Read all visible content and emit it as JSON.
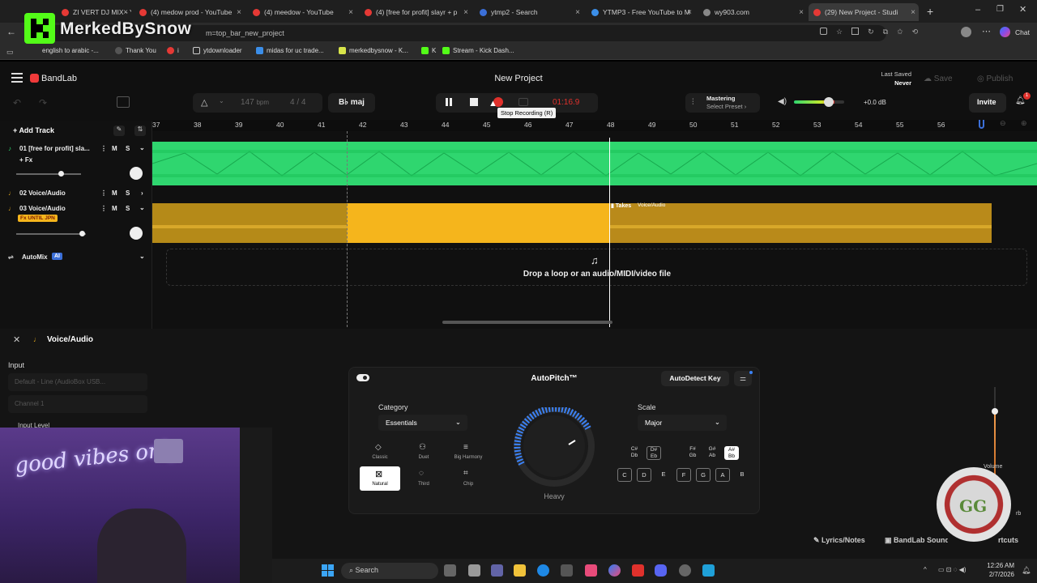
{
  "browser": {
    "tabs": [
      {
        "label": "ZI VERT DJ MIX - Yo",
        "fav": "#e53935"
      },
      {
        "label": "(4) medow prod - YouTube",
        "fav": "#e53935"
      },
      {
        "label": "(4) meedow - YouTube",
        "fav": "#e53935"
      },
      {
        "label": "(4) [free for profit] slayr + p",
        "fav": "#e53935"
      },
      {
        "label": "ytmp2 - Search",
        "fav": "#3b6fd8"
      },
      {
        "label": "YTMP3 - Free YouTube to M",
        "fav": "#3b8ee8"
      },
      {
        "label": "wy903.com",
        "fav": "#888"
      },
      {
        "label": "(29) New Project - Studi",
        "fav": "#e53935"
      }
    ],
    "url_fragment": "m=top_bar_new_project",
    "overlay_name": "MerkedBySnow",
    "chat_label": "Chat",
    "bookmarks": [
      "english to arabic -...",
      "Thank You",
      "i",
      "ytdownloader",
      "midas for uc trade...",
      "merkedbysnow - K...",
      "K",
      "Stream - Kick Dash..."
    ]
  },
  "app": {
    "brand": "BandLab",
    "project_title": "New Project",
    "last_saved_label": "Last Saved",
    "last_saved_value": "Never",
    "save_label": "Save",
    "publish_label": "Publish",
    "invite_label": "Invite",
    "notification_count": "1",
    "bpm_value": "147",
    "bpm_unit": "bpm",
    "time_sig": "4 / 4",
    "key": "B♭ maj",
    "time_display": "01:16.9",
    "tooltip": "Stop Recording (R)",
    "mastering_label": "Mastering",
    "mastering_preset": "Select Preset",
    "gain_label": "+0.0 dB",
    "add_track_label": "Add Track",
    "ruler": [
      "37",
      "38",
      "39",
      "40",
      "41",
      "42",
      "43",
      "44",
      "45",
      "46",
      "47",
      "48",
      "49",
      "50",
      "51",
      "52",
      "53",
      "54",
      "55",
      "56"
    ],
    "tracks": [
      {
        "name": "01  [free for profit] sla...",
        "sub": "+ Fx"
      },
      {
        "name": "02  Voice/Audio"
      },
      {
        "name": "03  Voice/Audio",
        "badge": "Fx UNTIL JPN"
      }
    ],
    "automix_label": "AutoMix",
    "automix_badge": "AI",
    "takes_label": "Takes",
    "clip_label": "Voice/Audio",
    "drop_text": "Drop a loop or an audio/MIDI/video file"
  },
  "panel": {
    "title": "Voice/Audio",
    "input_label": "Input",
    "input_device": "Default - Line (AudioBox USB...",
    "channel": "Channel 1",
    "input_level": "Input Level",
    "autopitch_title": "AutoPitch™",
    "autodetect_label": "AutoDetect Key",
    "category_label": "Category",
    "category_value": "Essentials",
    "scale_label": "Scale",
    "scale_value": "Major",
    "amount_label": "Heavy",
    "options": [
      "Classic",
      "Duet",
      "Big Harmony",
      "Natural",
      "Third",
      "Chip"
    ],
    "sharp_keys": [
      "C#\nDb",
      "D#\nEb",
      "F#\nGb",
      "G#\nAb",
      "A#\nBb"
    ],
    "natural_keys": [
      "C",
      "D",
      "E",
      "F",
      "G",
      "A",
      "B"
    ],
    "volume_label": "Volume",
    "reverb_label": "rb",
    "lyrics_label": "Lyrics/Notes",
    "sounds_label": "BandLab Sounds",
    "shortcuts_label": "rtcuts"
  },
  "taskbar": {
    "search": "Search",
    "time": "12:26 AM",
    "date": "2/7/2026"
  },
  "colors": {
    "green_track": "#2fd66f",
    "orange_track": "#f5b51c",
    "record_red": "#e0312c",
    "accent_blue": "#3b82f6"
  }
}
